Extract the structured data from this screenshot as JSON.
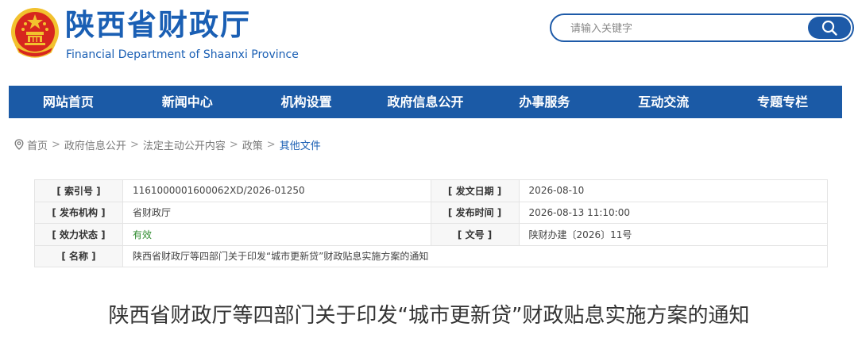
{
  "header": {
    "title": "陕西省财政厅",
    "subtitle": "Financial Department of Shaanxi Province",
    "search_placeholder": "请输入关键字"
  },
  "nav": {
    "items": [
      "网站首页",
      "新闻中心",
      "机构设置",
      "政府信息公开",
      "办事服务",
      "互动交流",
      "专题专栏"
    ]
  },
  "breadcrumb": {
    "items": [
      "首页",
      "政府信息公开",
      "法定主动公开内容",
      "政策",
      "其他文件"
    ],
    "separator": ">"
  },
  "info": {
    "index_label": "[ 索引号 ]",
    "index_value": "1161000001600062XD/2026-01250",
    "date_label": "[ 发文日期 ]",
    "date_value": "2026-08-10",
    "org_label": "[ 发布机构 ]",
    "org_value": "省财政厅",
    "time_label": "[ 发布时间 ]",
    "time_value": "2026-08-13 11:10:00",
    "status_label": "[ 效力状态 ]",
    "status_value": "有效",
    "docno_label": "[ 文号 ]",
    "docno_value": "陕财办建〔2026〕11号",
    "name_label": "[ 名称 ]",
    "name_value": "陕西省财政厅等四部门关于印发“城市更新贷”财政贴息实施方案的通知"
  },
  "article": {
    "title": "陕西省财政厅等四部门关于印发“城市更新贷”财政贴息实施方案的通知"
  },
  "colors": {
    "brand_blue": "#1b5aa6",
    "title_blue": "#1a5fb4",
    "emblem_red": "#d7261e",
    "emblem_gold": "#f2c12e",
    "valid_green": "#2e8b2e"
  }
}
